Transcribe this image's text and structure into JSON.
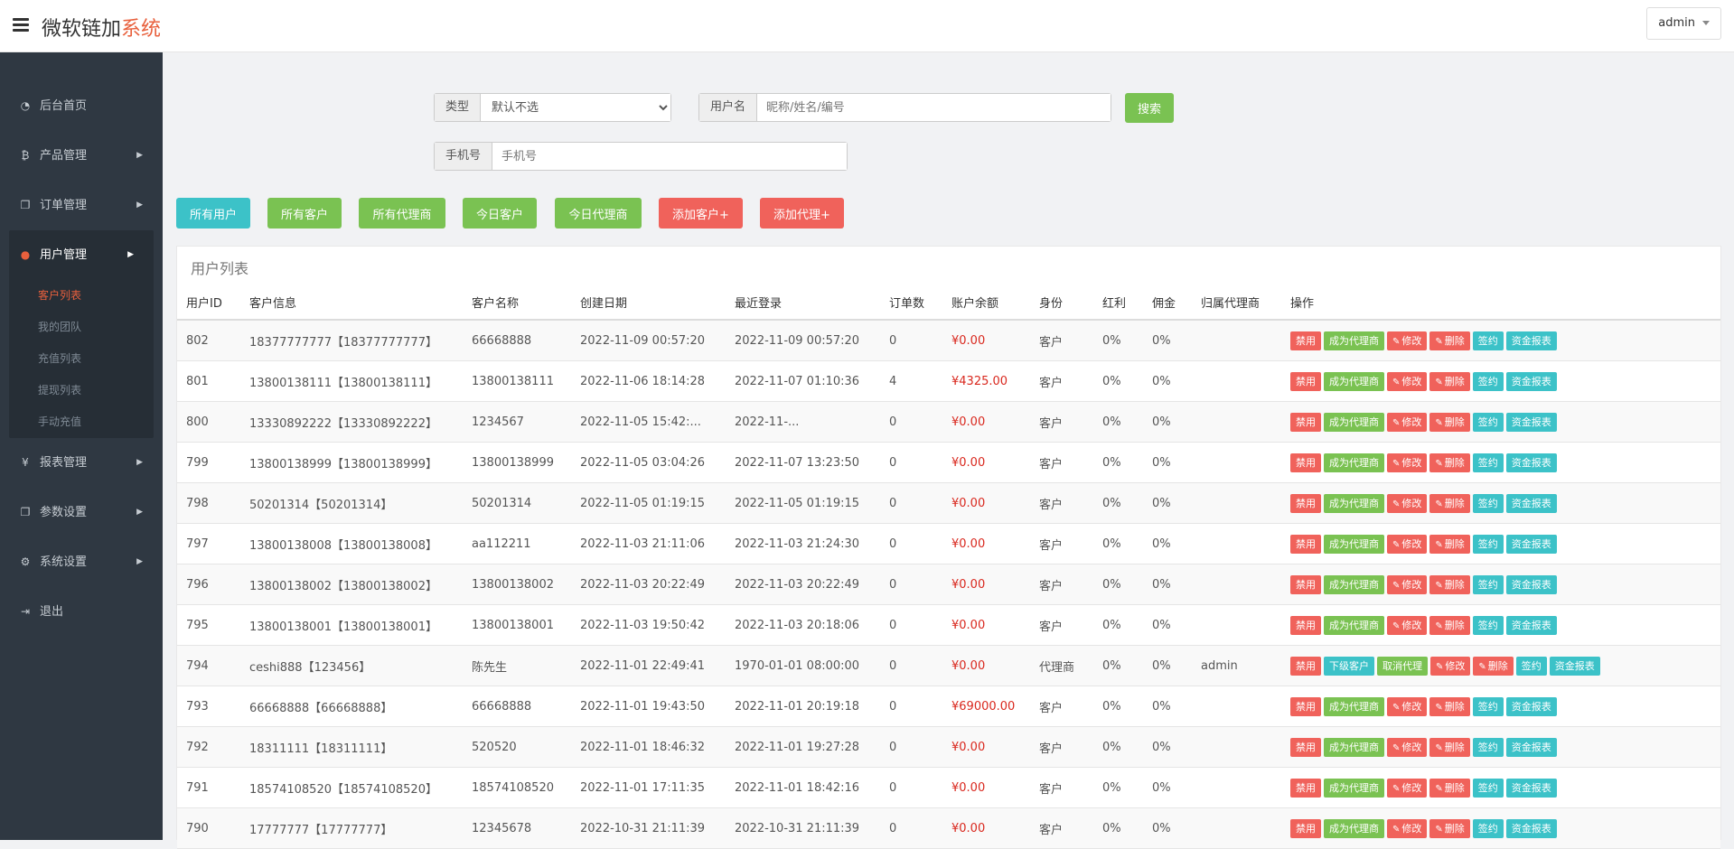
{
  "header": {
    "brand_main": "微软链加",
    "brand_accent": "系统",
    "user": "admin"
  },
  "sidebar": {
    "items": [
      {
        "label": "后台首页",
        "icon": "dashboard-icon"
      },
      {
        "label": "产品管理",
        "icon": "bitcoin-icon"
      },
      {
        "label": "订单管理",
        "icon": "copy-icon"
      },
      {
        "label": "用户管理",
        "icon": "user-icon"
      },
      {
        "label": "报表管理",
        "icon": "yen-icon"
      },
      {
        "label": "参数设置",
        "icon": "copy-icon"
      },
      {
        "label": "系统设置",
        "icon": "gears-icon"
      },
      {
        "label": "退出",
        "icon": "sign-out-icon"
      }
    ],
    "user_sub": [
      "客户列表",
      "我的团队",
      "充值列表",
      "提现列表",
      "手动充值"
    ]
  },
  "filters": {
    "type_label": "类型",
    "type_value": "默认不选",
    "username_label": "用户名",
    "username_placeholder": "昵称/姓名/编号",
    "search_label": "搜索",
    "phone_label": "手机号",
    "phone_placeholder": "手机号"
  },
  "quick_buttons": [
    "所有用户",
    "所有客户",
    "所有代理商",
    "今日客户",
    "今日代理商",
    "添加客户+",
    "添加代理+"
  ],
  "table": {
    "title": "用户列表",
    "headers": [
      "用户ID",
      "客户信息",
      "客户名称",
      "创建日期",
      "最近登录",
      "订单数",
      "账户余额",
      "身份",
      "红利",
      "佣金",
      "归属代理商",
      "操作"
    ],
    "rows": [
      [
        "802",
        "18377777777【18377777777】",
        "66668888",
        "2022-11-09 00:57:20",
        "2022-11-09 00:57:20",
        "0",
        "¥0.00",
        "客户",
        "0%",
        "0%",
        ""
      ],
      [
        "801",
        "13800138111【13800138111】",
        "13800138111",
        "2022-11-06 18:14:28",
        "2022-11-07 01:10:36",
        "4",
        "¥4325.00",
        "客户",
        "0%",
        "0%",
        ""
      ],
      [
        "800",
        "13330892222【13330892222】",
        "1234567",
        "2022-11-05 15:42:...",
        "2022-11-...",
        "0",
        "¥0.00",
        "客户",
        "0%",
        "0%",
        ""
      ],
      [
        "799",
        "13800138999【13800138999】",
        "13800138999",
        "2022-11-05 03:04:26",
        "2022-11-07 13:23:50",
        "0",
        "¥0.00",
        "客户",
        "0%",
        "0%",
        ""
      ],
      [
        "798",
        "50201314【50201314】",
        "50201314",
        "2022-11-05 01:19:15",
        "2022-11-05 01:19:15",
        "0",
        "¥0.00",
        "客户",
        "0%",
        "0%",
        ""
      ],
      [
        "797",
        "13800138008【13800138008】",
        "aa112211",
        "2022-11-03 21:11:06",
        "2022-11-03 21:24:30",
        "0",
        "¥0.00",
        "客户",
        "0%",
        "0%",
        ""
      ],
      [
        "796",
        "13800138002【13800138002】",
        "13800138002",
        "2022-11-03 20:22:49",
        "2022-11-03 20:22:49",
        "0",
        "¥0.00",
        "客户",
        "0%",
        "0%",
        ""
      ],
      [
        "795",
        "13800138001【13800138001】",
        "13800138001",
        "2022-11-03 19:50:42",
        "2022-11-03 20:18:06",
        "0",
        "¥0.00",
        "客户",
        "0%",
        "0%",
        ""
      ],
      [
        "794",
        "ceshi888【123456】",
        "陈先生",
        "2022-11-01 22:49:41",
        "1970-01-01 08:00:00",
        "0",
        "¥0.00",
        "代理商",
        "0%",
        "0%",
        "admin"
      ],
      [
        "793",
        "66668888【66668888】",
        "66668888",
        "2022-11-01 19:43:50",
        "2022-11-01 20:19:18",
        "0",
        "¥69000.00",
        "客户",
        "0%",
        "0%",
        ""
      ],
      [
        "792",
        "18311111【18311111】",
        "520520",
        "2022-11-01 18:46:32",
        "2022-11-01 19:27:28",
        "0",
        "¥0.00",
        "客户",
        "0%",
        "0%",
        ""
      ],
      [
        "791",
        "18574108520【18574108520】",
        "18574108520",
        "2022-11-01 17:11:35",
        "2022-11-01 18:42:16",
        "0",
        "¥0.00",
        "客户",
        "0%",
        "0%",
        ""
      ],
      [
        "790",
        "17777777【17777777】",
        "12345678",
        "2022-10-31 21:11:39",
        "2022-10-31 21:11:39",
        "0",
        "¥0.00",
        "客户",
        "0%",
        "0%",
        ""
      ]
    ],
    "row_actions": [
      "禁用",
      "成为代理商",
      "修改",
      "删除",
      "签约",
      "资金报表"
    ],
    "agent_actions": [
      "禁用",
      "下级客户",
      "取消代理",
      "修改",
      "删除",
      "签约",
      "资金报表"
    ]
  },
  "colors": {
    "sidebar_bg": "#2f3842",
    "accent": "#e8603d",
    "green": "#7ac252",
    "cyan": "#3cc2c8",
    "red": "#f0625b",
    "money": "#d9281e"
  }
}
